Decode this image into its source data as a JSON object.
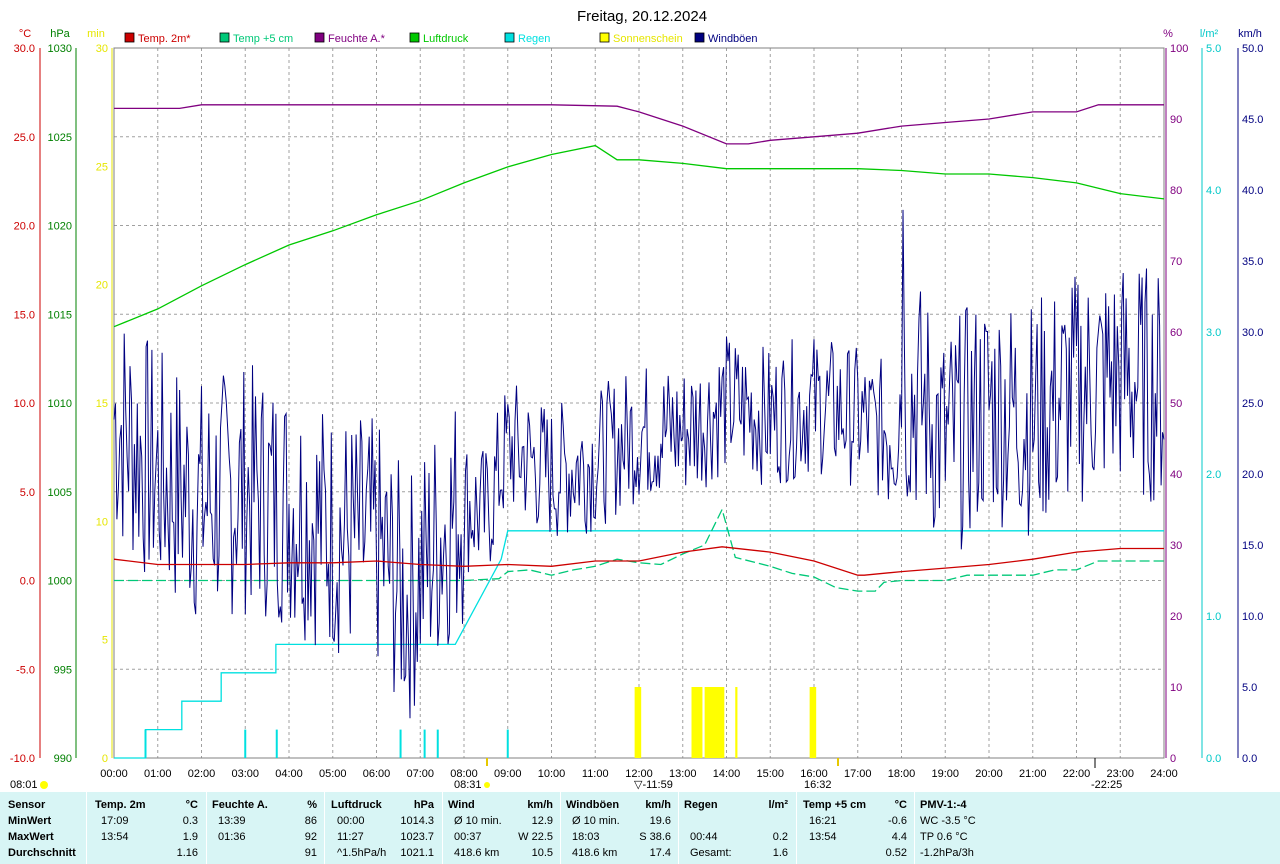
{
  "page_title": "Freitag, 20.12.2024",
  "chart_data": {
    "type": "line",
    "title": "Freitag, 20.12.2024",
    "x_ticks": [
      "00:00",
      "01:00",
      "02:00",
      "03:00",
      "04:00",
      "05:00",
      "06:00",
      "07:00",
      "08:00",
      "09:00",
      "10:00",
      "11:00",
      "12:00",
      "13:00",
      "14:00",
      "15:00",
      "16:00",
      "17:00",
      "18:00",
      "19:00",
      "20:00",
      "21:00",
      "22:00",
      "23:00",
      "24:00"
    ],
    "axes": {
      "temp": {
        "unit": "°C",
        "range": [
          -10,
          30
        ],
        "ticks": [
          "30.0",
          "25.0",
          "20.0",
          "15.0",
          "10.0",
          "5.0",
          "0.0",
          "-5.0",
          "-10.0"
        ],
        "color": "#cc0000"
      },
      "pressure": {
        "unit": "hPa",
        "range": [
          990,
          1030
        ],
        "ticks": [
          "1030",
          "1025",
          "1020",
          "1015",
          "1010",
          "1005",
          "1000",
          "995",
          "990"
        ],
        "color": "#008000"
      },
      "sunshine": {
        "unit": "min",
        "range": [
          0,
          30
        ],
        "ticks": [
          "30",
          "25",
          "20",
          "15",
          "10",
          "5",
          "0"
        ],
        "color": "#e6e600"
      },
      "humidity": {
        "unit": "%",
        "range": [
          0,
          100
        ],
        "ticks": [
          "100",
          "90",
          "80",
          "70",
          "60",
          "50",
          "40",
          "30",
          "20",
          "10",
          "0"
        ],
        "color": "#800080"
      },
      "rain": {
        "unit": "l/m²",
        "range": [
          0,
          5
        ],
        "ticks": [
          "5.0",
          "4.0",
          "3.0",
          "2.0",
          "1.0",
          "0.0"
        ],
        "color": "#00c8c8"
      },
      "wind": {
        "unit": "km/h",
        "range": [
          0,
          50
        ],
        "ticks": [
          "50.0",
          "45.0",
          "40.0",
          "35.0",
          "30.0",
          "25.0",
          "20.0",
          "15.0",
          "10.0",
          "5.0",
          "0.0"
        ],
        "color": "#000080"
      }
    },
    "legend": [
      {
        "name": "Temp. 2m*",
        "color": "#cc0000"
      },
      {
        "name": "Temp +5 cm",
        "color": "#00c878"
      },
      {
        "name": "Feuchte A.*",
        "color": "#800080"
      },
      {
        "name": "Luftdruck",
        "color": "#00c800"
      },
      {
        "name": "Regen",
        "color": "#00e0e0"
      },
      {
        "name": "Sonnenschein",
        "color": "#ffff00"
      },
      {
        "name": "Windböen",
        "color": "#000080"
      }
    ],
    "sun_events": {
      "sunrise": "08:31",
      "noon": "11:59",
      "sunset": "16:32",
      "moonrise": "08:01",
      "moonset": "22:25"
    },
    "series": {
      "temp2m": [
        [
          0,
          1.2
        ],
        [
          1,
          0.9
        ],
        [
          2,
          0.9
        ],
        [
          3,
          0.9
        ],
        [
          4,
          1.0
        ],
        [
          5,
          1.0
        ],
        [
          6,
          1.1
        ],
        [
          7,
          0.9
        ],
        [
          8,
          0.8
        ],
        [
          9,
          0.9
        ],
        [
          10,
          0.8
        ],
        [
          11,
          1.1
        ],
        [
          12,
          1.1
        ],
        [
          13,
          1.6
        ],
        [
          13.9,
          1.9
        ],
        [
          15,
          1.6
        ],
        [
          16,
          1.1
        ],
        [
          17,
          0.3
        ],
        [
          17.15,
          0.3
        ],
        [
          18,
          0.5
        ],
        [
          19,
          0.7
        ],
        [
          20,
          0.9
        ],
        [
          21,
          1.2
        ],
        [
          22,
          1.6
        ],
        [
          23,
          1.8
        ],
        [
          24,
          1.8
        ]
      ],
      "temp5cm": [
        [
          0,
          0.0
        ],
        [
          1,
          0.0
        ],
        [
          2,
          0.0
        ],
        [
          3,
          0.0
        ],
        [
          4,
          0.0
        ],
        [
          5,
          0.0
        ],
        [
          6,
          0.0
        ],
        [
          7,
          0.0
        ],
        [
          8,
          0.0
        ],
        [
          8.8,
          0.1
        ],
        [
          9,
          0.5
        ],
        [
          9.5,
          0.6
        ],
        [
          10,
          0.3
        ],
        [
          10.5,
          0.6
        ],
        [
          11,
          0.8
        ],
        [
          11.5,
          1.2
        ],
        [
          12,
          1.0
        ],
        [
          12.5,
          0.9
        ],
        [
          13,
          1.5
        ],
        [
          13.5,
          2.0
        ],
        [
          13.9,
          4.0
        ],
        [
          14.2,
          1.3
        ],
        [
          15,
          0.8
        ],
        [
          15.5,
          0.4
        ],
        [
          16,
          0.2
        ],
        [
          16.5,
          -0.4
        ],
        [
          17,
          -0.6
        ],
        [
          17.4,
          -0.6
        ],
        [
          17.6,
          -0.1
        ],
        [
          18,
          0.0
        ],
        [
          19,
          0.0
        ],
        [
          19.5,
          0.3
        ],
        [
          20,
          0.3
        ],
        [
          21,
          0.3
        ],
        [
          21.5,
          0.6
        ],
        [
          22,
          0.6
        ],
        [
          22.5,
          1.1
        ],
        [
          24,
          1.1
        ]
      ],
      "humidity": [
        [
          0,
          91.5
        ],
        [
          1.5,
          91.5
        ],
        [
          2,
          92
        ],
        [
          5,
          92
        ],
        [
          10,
          92
        ],
        [
          11.5,
          91.8
        ],
        [
          12,
          91
        ],
        [
          13,
          89
        ],
        [
          14,
          86.5
        ],
        [
          14.5,
          86.5
        ],
        [
          15,
          87
        ],
        [
          16,
          87.5
        ],
        [
          17,
          88
        ],
        [
          18,
          89
        ],
        [
          19,
          89.5
        ],
        [
          20,
          90
        ],
        [
          21,
          91
        ],
        [
          22,
          91
        ],
        [
          22.5,
          92
        ],
        [
          24,
          92
        ]
      ],
      "pressure": [
        [
          0,
          1014.3
        ],
        [
          1,
          1015.3
        ],
        [
          2,
          1016.6
        ],
        [
          3,
          1017.8
        ],
        [
          4,
          1018.9
        ],
        [
          5,
          1019.7
        ],
        [
          6,
          1020.6
        ],
        [
          7,
          1021.4
        ],
        [
          8,
          1022.4
        ],
        [
          9,
          1023.3
        ],
        [
          10,
          1024.0
        ],
        [
          11,
          1024.5
        ],
        [
          11.5,
          1023.7
        ],
        [
          12,
          1023.7
        ],
        [
          13,
          1023.5
        ],
        [
          14,
          1023.2
        ],
        [
          15,
          1023.2
        ],
        [
          16,
          1023.2
        ],
        [
          17,
          1023.2
        ],
        [
          18,
          1023.1
        ],
        [
          19,
          1022.9
        ],
        [
          20,
          1022.9
        ],
        [
          21,
          1022.7
        ],
        [
          22,
          1022.4
        ],
        [
          23,
          1021.8
        ],
        [
          24,
          1021.5
        ]
      ],
      "rain_cum": [
        [
          0,
          0
        ],
        [
          0.72,
          0
        ],
        [
          0.72,
          0.2
        ],
        [
          1.55,
          0.2
        ],
        [
          1.55,
          0.4
        ],
        [
          2.45,
          0.4
        ],
        [
          2.45,
          0.6
        ],
        [
          3.7,
          0.6
        ],
        [
          3.7,
          0.8
        ],
        [
          6.8,
          0.8
        ],
        [
          7.8,
          0.8
        ],
        [
          8.85,
          1.4
        ],
        [
          9,
          1.6
        ],
        [
          24,
          1.6
        ]
      ],
      "rain_ticks": [
        0.72,
        3.0,
        3.72,
        6.55,
        7.1,
        7.4,
        9.0
      ],
      "sunshine_bars": [
        [
          11.9,
          12.05
        ],
        [
          13.2,
          13.45
        ],
        [
          13.5,
          13.95
        ],
        [
          14.2,
          14.25
        ],
        [
          15.9,
          16.05
        ]
      ],
      "wind_gust_peak": [
        18.03,
        38.6
      ]
    }
  },
  "stats": {
    "columns": [
      {
        "name": "col-sensor",
        "header": "Sensor",
        "unit": "",
        "rows": [
          [
            "MinWert",
            ""
          ],
          [
            "MaxWert",
            ""
          ],
          [
            "Durchschnitt",
            ""
          ]
        ]
      },
      {
        "name": "col-temp2m",
        "header": "Temp. 2m",
        "unit": "°C",
        "rows": [
          [
            "17:09",
            "0.3"
          ],
          [
            "13:54",
            "1.9"
          ],
          [
            "",
            "1.16"
          ]
        ]
      },
      {
        "name": "col-humidity",
        "header": "Feuchte A.",
        "unit": "%",
        "rows": [
          [
            "13:39",
            "86"
          ],
          [
            "01:36",
            "92"
          ],
          [
            "",
            "91"
          ]
        ]
      },
      {
        "name": "col-pressure",
        "header": "Luftdruck",
        "unit": "hPa",
        "rows": [
          [
            "00:00",
            "1014.3"
          ],
          [
            "11:27",
            "1023.7"
          ],
          [
            "^1.5hPa/h",
            "1021.1"
          ]
        ]
      },
      {
        "name": "col-wind",
        "header": "Wind",
        "unit": "km/h",
        "rows": [
          [
            "Ø 10 min.",
            "12.9"
          ],
          [
            "00:37",
            "W 22.5"
          ],
          [
            "418.6 km",
            "10.5"
          ]
        ]
      },
      {
        "name": "col-gusts",
        "header": "Windböen",
        "unit": "km/h",
        "rows": [
          [
            "Ø 10 min.",
            "19.6"
          ],
          [
            "18:03",
            "S 38.6"
          ],
          [
            "418.6 km",
            "17.4"
          ]
        ]
      },
      {
        "name": "col-rain",
        "header": "Regen",
        "unit": "l/m²",
        "rows": [
          [
            "",
            ""
          ],
          [
            "00:44",
            "0.2"
          ],
          [
            "Gesamt:",
            "1.6"
          ]
        ]
      },
      {
        "name": "col-temp5cm",
        "header": "Temp +5 cm",
        "unit": "°C",
        "rows": [
          [
            "16:21",
            "-0.6"
          ],
          [
            "13:54",
            "4.4"
          ],
          [
            "",
            "0.52"
          ]
        ]
      },
      {
        "name": "col-pmv",
        "header": "PMV-1:-4",
        "unit": "",
        "rows": [
          [
            "WC -3.5 °C",
            ""
          ],
          [
            "TP 0.6 °C",
            ""
          ],
          [
            "-1.2hPa/3h",
            ""
          ]
        ]
      }
    ]
  }
}
